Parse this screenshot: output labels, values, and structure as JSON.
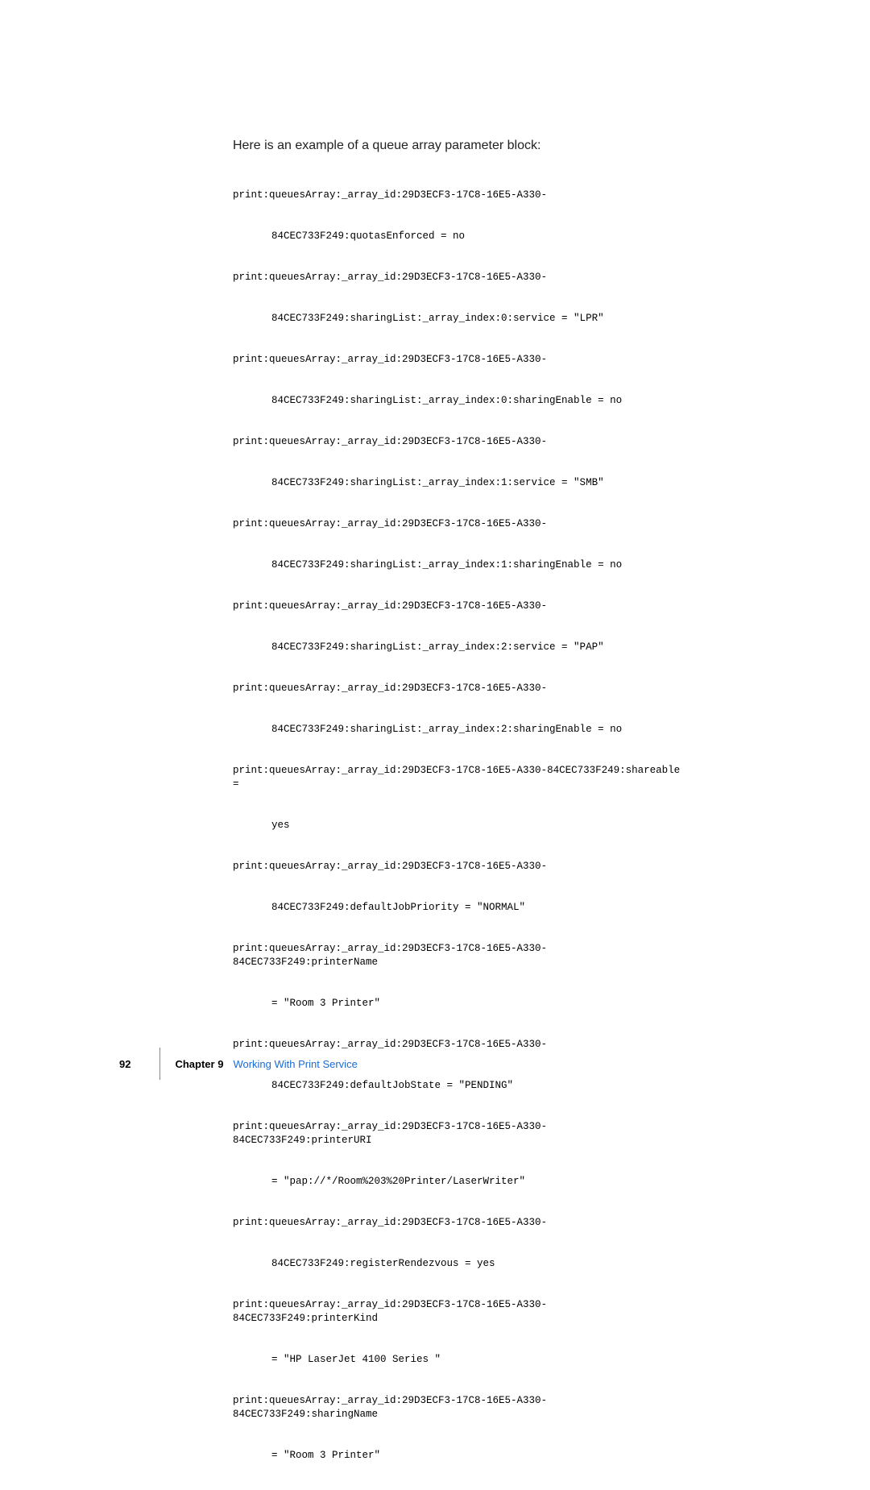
{
  "intro": "Here is an example of a queue array parameter block:",
  "code": {
    "l1": "print:queuesArray:_array_id:29D3ECF3-17C8-16E5-A330-",
    "c1": "84CEC733F249:quotasEnforced = no",
    "l2": "print:queuesArray:_array_id:29D3ECF3-17C8-16E5-A330-",
    "c2": "84CEC733F249:sharingList:_array_index:0:service = \"LPR\"",
    "l3": "print:queuesArray:_array_id:29D3ECF3-17C8-16E5-A330-",
    "c3": "84CEC733F249:sharingList:_array_index:0:sharingEnable = no",
    "l4": "print:queuesArray:_array_id:29D3ECF3-17C8-16E5-A330-",
    "c4": "84CEC733F249:sharingList:_array_index:1:service = \"SMB\"",
    "l5": "print:queuesArray:_array_id:29D3ECF3-17C8-16E5-A330-",
    "c5": "84CEC733F249:sharingList:_array_index:1:sharingEnable = no",
    "l6": "print:queuesArray:_array_id:29D3ECF3-17C8-16E5-A330-",
    "c6": "84CEC733F249:sharingList:_array_index:2:service = \"PAP\"",
    "l7": "print:queuesArray:_array_id:29D3ECF3-17C8-16E5-A330-",
    "c7": "84CEC733F249:sharingList:_array_index:2:sharingEnable = no",
    "l8": "print:queuesArray:_array_id:29D3ECF3-17C8-16E5-A330-84CEC733F249:shareable = ",
    "c8": "yes",
    "l9": "print:queuesArray:_array_id:29D3ECF3-17C8-16E5-A330-",
    "c9": "84CEC733F249:defaultJobPriority = \"NORMAL\"",
    "l10": "print:queuesArray:_array_id:29D3ECF3-17C8-16E5-A330-84CEC733F249:printerName ",
    "c10": "= \"Room 3 Printer\"",
    "l11": "print:queuesArray:_array_id:29D3ECF3-17C8-16E5-A330-",
    "c11": "84CEC733F249:defaultJobState = \"PENDING\"",
    "l12": "print:queuesArray:_array_id:29D3ECF3-17C8-16E5-A330-84CEC733F249:printerURI ",
    "c12": "= \"pap://*/Room%203%20Printer/LaserWriter\"",
    "l13": "print:queuesArray:_array_id:29D3ECF3-17C8-16E5-A330-",
    "c13": "84CEC733F249:registerRendezvous = yes",
    "l14": "print:queuesArray:_array_id:29D3ECF3-17C8-16E5-A330-84CEC733F249:printerKind ",
    "c14": "= \"HP LaserJet 4100 Series \"",
    "l15": "print:queuesArray:_array_id:29D3ECF3-17C8-16E5-A330-84CEC733F249:sharingName ",
    "c15": "= \"Room 3 Printer\""
  },
  "footer": {
    "page_number": "92",
    "chapter_label": "Chapter 9",
    "chapter_title": "Working With Print Service"
  }
}
